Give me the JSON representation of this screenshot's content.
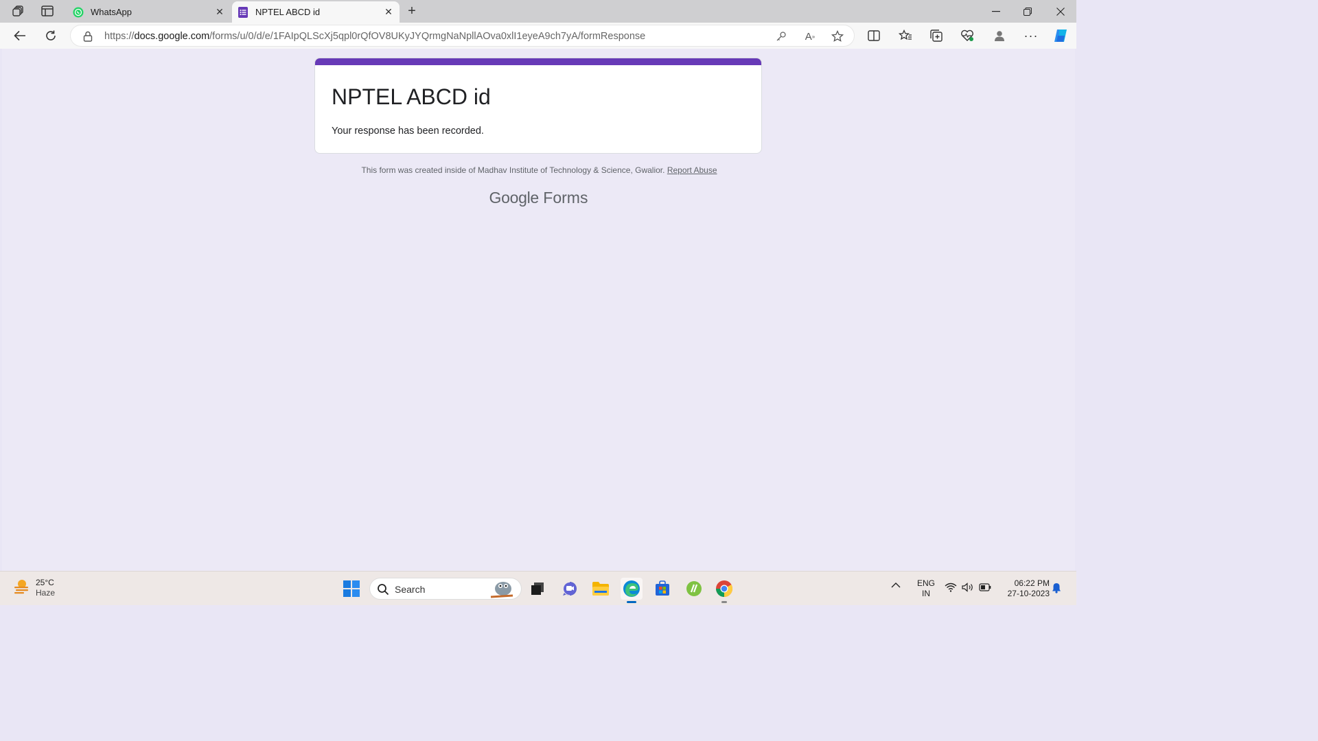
{
  "browser": {
    "tabs": [
      {
        "title": "WhatsApp",
        "icon": "whatsapp-icon",
        "active": false
      },
      {
        "title": "NPTEL ABCD id",
        "icon": "google-forms-icon",
        "active": true
      }
    ],
    "url_prefix": "https://",
    "url_host": "docs.google.com",
    "url_path": "/forms/u/0/d/e/1FAIpQLScXj5qpl0rQfOV8UKyJYQrmgNaNpllAOva0xlI1eyeA9ch7yA/formResponse"
  },
  "form": {
    "title": "NPTEL ABCD id",
    "message": "Your response has been recorded.",
    "accent_color": "#673ab7"
  },
  "footer": {
    "note": "This form was created inside of Madhav Institute of Technology & Science, Gwalior.",
    "report_link": "Report Abuse",
    "brand_google": "Google",
    "brand_forms": "Forms"
  },
  "taskbar": {
    "weather_temp": "25°C",
    "weather_desc": "Haze",
    "search_label": "Search",
    "lang_top": "ENG",
    "lang_bottom": "IN",
    "time": "06:22 PM",
    "date": "27-10-2023"
  }
}
